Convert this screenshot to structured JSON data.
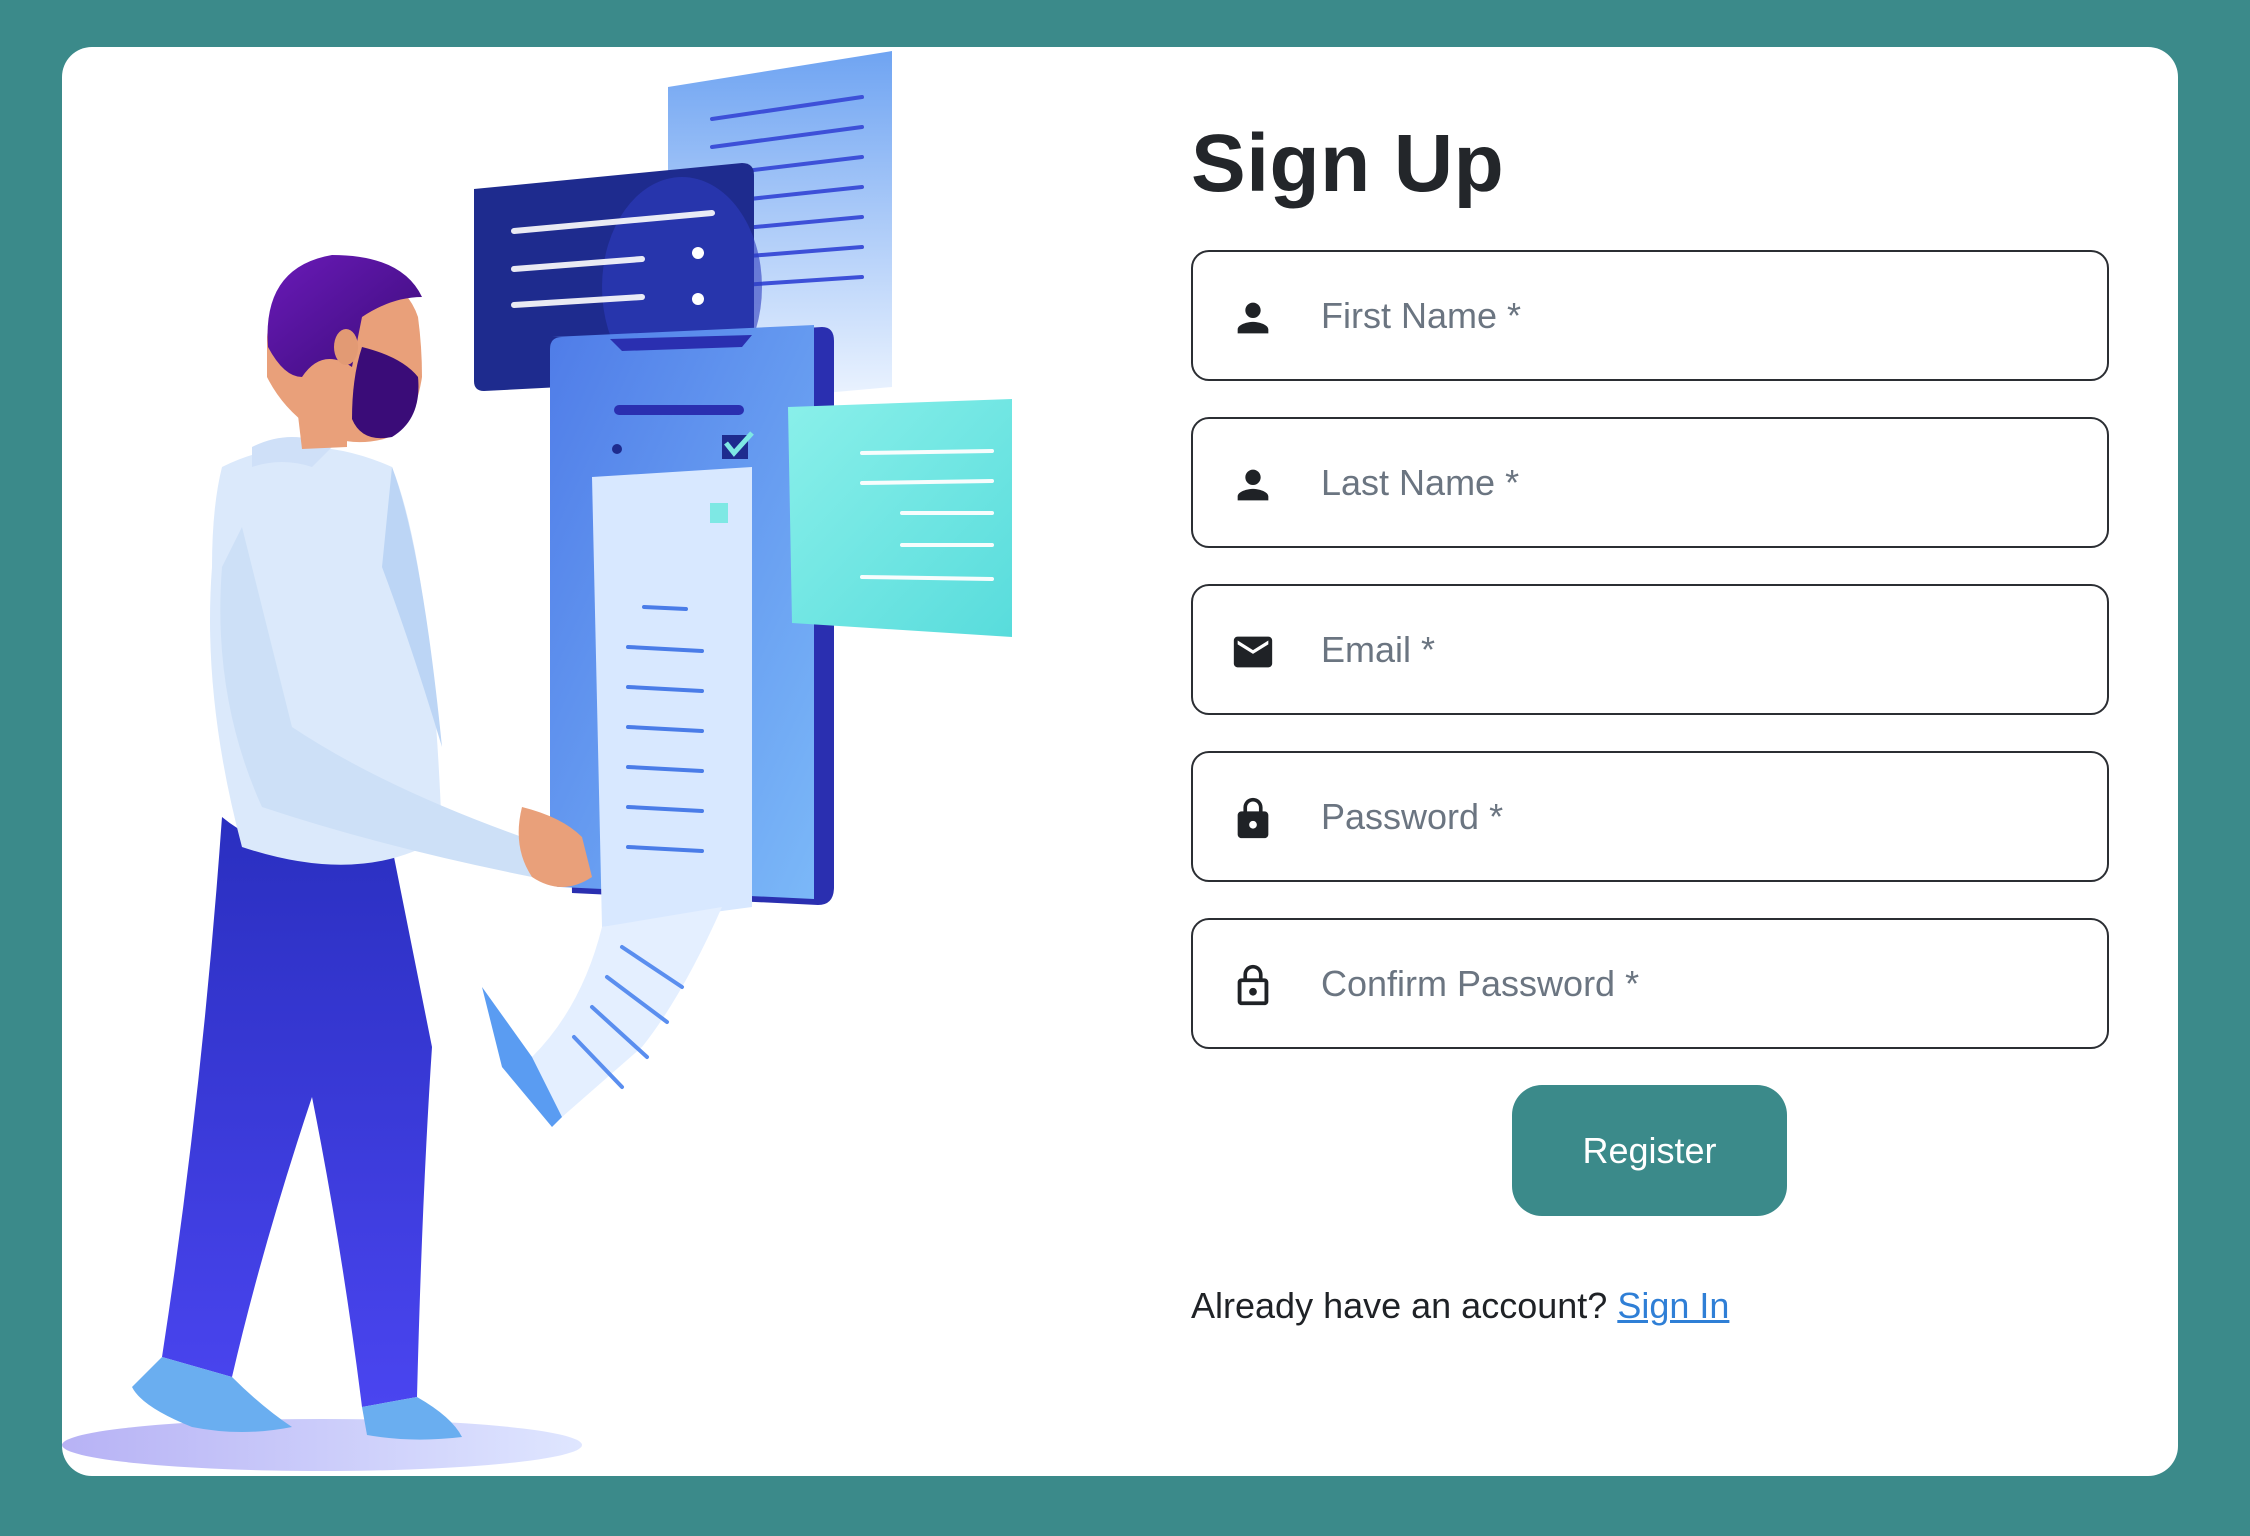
{
  "form": {
    "title": "Sign Up",
    "fields": [
      {
        "icon": "person-icon",
        "placeholder": "First Name *",
        "value": ""
      },
      {
        "icon": "person-icon",
        "placeholder": "Last Name *",
        "value": ""
      },
      {
        "icon": "mail-icon",
        "placeholder": "Email *",
        "value": ""
      },
      {
        "icon": "lock-icon",
        "placeholder": "Password *",
        "value": ""
      },
      {
        "icon": "lock-open-outline-icon",
        "placeholder": "Confirm Password *",
        "value": ""
      }
    ],
    "register_label": "Register",
    "signin_prompt": "Already have an account?",
    "signin_link": "Sign In"
  },
  "colors": {
    "background": "#3b8a8a",
    "card": "#ffffff",
    "button": "#3b8a8a",
    "link": "#2f7fd6",
    "illustration_primary": "#3a3fd6",
    "illustration_accent": "#7ee8e4"
  }
}
